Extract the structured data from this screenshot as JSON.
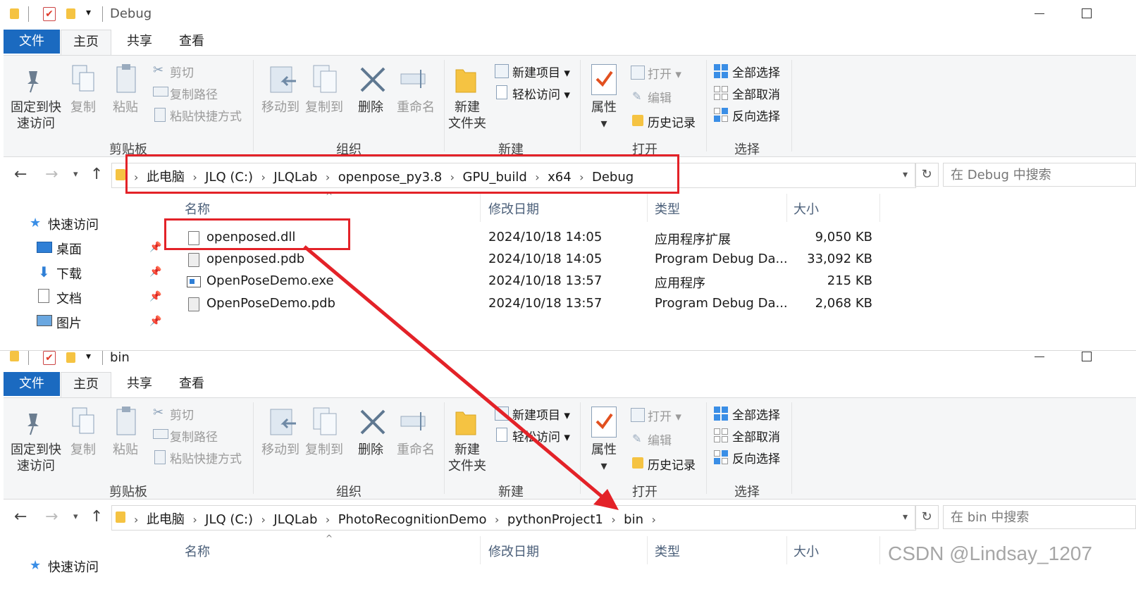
{
  "ribbon": {
    "tabs": {
      "file": "文件",
      "home": "主页",
      "share": "共享",
      "view": "查看"
    },
    "clipboard": {
      "pin": "固定到快\n速访问",
      "copy": "复制",
      "paste": "粘贴",
      "cut": "剪切",
      "copy_path": "复制路径",
      "paste_shortcut": "粘贴快捷方式",
      "group": "剪贴板"
    },
    "organize": {
      "move_to": "移动到",
      "copy_to": "复制到",
      "delete": "删除",
      "rename": "重命名",
      "group": "组织"
    },
    "new": {
      "new_folder": "新建\n文件夹",
      "new_item": "新建项目",
      "easy_access": "轻松访问",
      "group": "新建"
    },
    "open": {
      "properties": "属性",
      "open": "打开",
      "edit": "编辑",
      "history": "历史记录",
      "group": "打开"
    },
    "select": {
      "select_all": "全部选择",
      "select_none": "全部取消",
      "invert": "反向选择",
      "group": "选择"
    }
  },
  "window1": {
    "title": "Debug",
    "breadcrumb": [
      "此电脑",
      "JLQ (C:)",
      "JLQLab",
      "openpose_py3.8",
      "GPU_build",
      "x64",
      "Debug"
    ],
    "search_placeholder": "在 Debug 中搜索",
    "columns": {
      "name": "名称",
      "date": "修改日期",
      "type": "类型",
      "size": "大小"
    },
    "nav": [
      "快速访问",
      "桌面",
      "下载",
      "文档",
      "图片"
    ],
    "files": [
      {
        "name": "openposed.dll",
        "date": "2024/10/18 14:05",
        "type": "应用程序扩展",
        "size": "9,050 KB",
        "icon": "dll-icon"
      },
      {
        "name": "openposed.pdb",
        "date": "2024/10/18 14:05",
        "type": "Program Debug Da...",
        "size": "33,092 KB",
        "icon": "pdb-icon"
      },
      {
        "name": "OpenPoseDemo.exe",
        "date": "2024/10/18 13:57",
        "type": "应用程序",
        "size": "215 KB",
        "icon": "exe-icon"
      },
      {
        "name": "OpenPoseDemo.pdb",
        "date": "2024/10/18 13:57",
        "type": "Program Debug Da...",
        "size": "2,068 KB",
        "icon": "pdb-icon"
      }
    ]
  },
  "window2": {
    "title": "bin",
    "breadcrumb": [
      "此电脑",
      "JLQ (C:)",
      "JLQLab",
      "PhotoRecognitionDemo",
      "pythonProject1",
      "bin"
    ],
    "search_placeholder": "在 bin 中搜索",
    "columns": {
      "name": "名称",
      "date": "修改日期",
      "type": "类型",
      "size": "大小"
    },
    "nav": [
      "快速访问"
    ]
  },
  "watermark": "CSDN @Lindsay_1207",
  "colors": {
    "annotation": "#e32228",
    "file_tab": "#1b6ac0"
  }
}
